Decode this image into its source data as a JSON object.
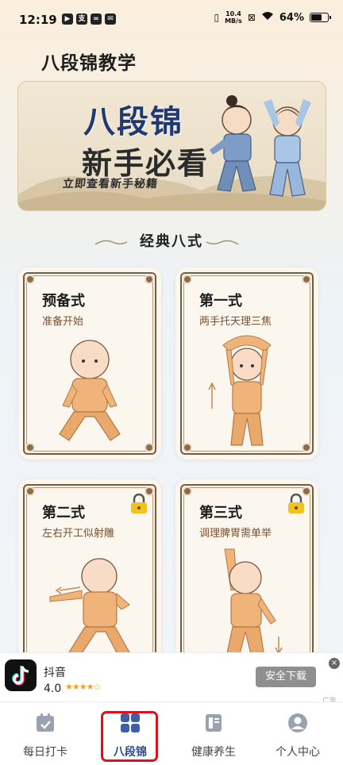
{
  "status_bar": {
    "time": "12:19",
    "network_speed": "10.4\nMB/s",
    "battery": "64%",
    "battery_level": 0.64
  },
  "page": {
    "title": "八段锦教学"
  },
  "banner": {
    "line1": "八段锦",
    "line2": "新手必看",
    "sub": "立即查看新手秘籍"
  },
  "section": {
    "title": "经典八式"
  },
  "cards": [
    {
      "name": "预备式",
      "desc": "准备开始",
      "locked": false
    },
    {
      "name": "第一式",
      "desc": "两手托天理三焦",
      "locked": false
    },
    {
      "name": "第二式",
      "desc": "左右开工似射雕",
      "locked": true
    },
    {
      "name": "第三式",
      "desc": "调理脾胃需单举",
      "locked": true
    }
  ],
  "ad": {
    "app_name": "抖音",
    "rating": "4.0",
    "stars": "★★★★☆",
    "button": "安全下载",
    "tag": "广告"
  },
  "nav": {
    "items": [
      {
        "label": "每日打卡",
        "icon": "calendar-check-icon"
      },
      {
        "label": "八段锦",
        "icon": "grid-icon"
      },
      {
        "label": "健康养生",
        "icon": "book-icon"
      },
      {
        "label": "个人中心",
        "icon": "person-icon"
      }
    ],
    "active_index": 1
  },
  "colors": {
    "accent": "#2d4a88",
    "highlight": "#e0101c",
    "card_text": "#7d4f2d"
  }
}
